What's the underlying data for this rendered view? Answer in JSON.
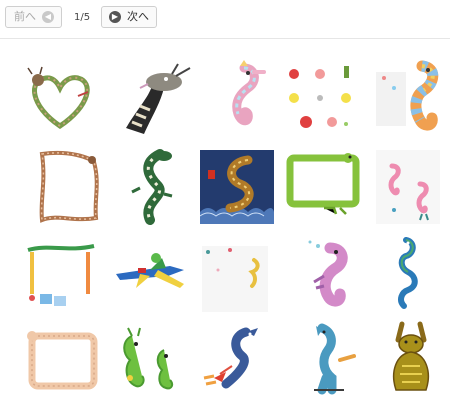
{
  "pager": {
    "prev_label": "前へ",
    "next_label": "次へ",
    "page_indicator": "1/5",
    "prev_icon": "chevron-left-icon",
    "next_icon": "chevron-right-icon"
  },
  "thumbnails": [
    {
      "name": "dragon-heart-wreath"
    },
    {
      "name": "dragon-head-striped"
    },
    {
      "name": "pastel-seahorse"
    },
    {
      "name": "flower-dots-pattern"
    },
    {
      "name": "rainbow-seahorse"
    },
    {
      "name": "dragon-frame-brown"
    },
    {
      "name": "green-dragon-climbing"
    },
    {
      "name": "dragon-on-blue-tile"
    },
    {
      "name": "green-crocodile-frame"
    },
    {
      "name": "pink-seahorses"
    },
    {
      "name": "dragon-bunting-frame"
    },
    {
      "name": "dragon-riding-plane"
    },
    {
      "name": "tiny-dragon-corner"
    },
    {
      "name": "pink-seahorse"
    },
    {
      "name": "blue-seahorses-dancing"
    },
    {
      "name": "rope-frame"
    },
    {
      "name": "green-dragon-pair"
    },
    {
      "name": "blue-dragon-fire"
    },
    {
      "name": "blue-dragon-standing"
    },
    {
      "name": "olive-dragon-sitting"
    }
  ]
}
